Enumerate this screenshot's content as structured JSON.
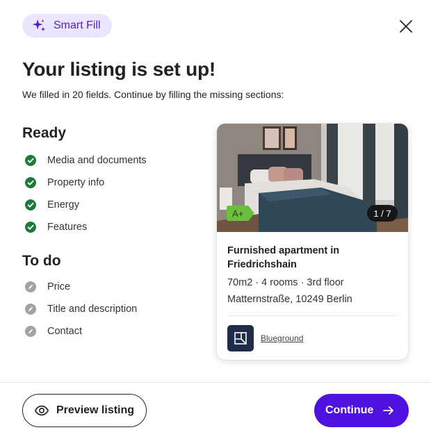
{
  "header": {
    "badge_label": "Smart Fill",
    "badge_icon": "sparkle-icon",
    "close_icon": "close-icon"
  },
  "intro": {
    "title": "Your listing is set up!",
    "subtitle": "We filled in 20 fields. Continue by filling the missing sections:"
  },
  "ready": {
    "heading": "Ready",
    "items": [
      {
        "label": "Media and documents",
        "status": "done"
      },
      {
        "label": "Property info",
        "status": "done"
      },
      {
        "label": "Energy",
        "status": "done"
      },
      {
        "label": "Features",
        "status": "done"
      }
    ]
  },
  "todo": {
    "heading": "To do",
    "items": [
      {
        "label": "Price",
        "status": "pending"
      },
      {
        "label": "Title and description",
        "status": "pending"
      },
      {
        "label": "Contact",
        "status": "pending"
      }
    ]
  },
  "card": {
    "energy_label": "A+",
    "photo_counter": "1 / 7",
    "title": "Furnished apartment in Friedrichshain",
    "details": "70m2 · 4 rooms · 3rd floor",
    "address": "Matternstraße, 10249 Berlin",
    "agency_name": "Blueground"
  },
  "footer": {
    "preview_label": "Preview listing",
    "continue_label": "Continue"
  },
  "colors": {
    "accent": "#4f11e0",
    "badge_bg": "#ece5ff",
    "done_green": "#1d7a3a",
    "pending_gray": "#a3a3a3",
    "energy_green": "#6cbf3e"
  }
}
